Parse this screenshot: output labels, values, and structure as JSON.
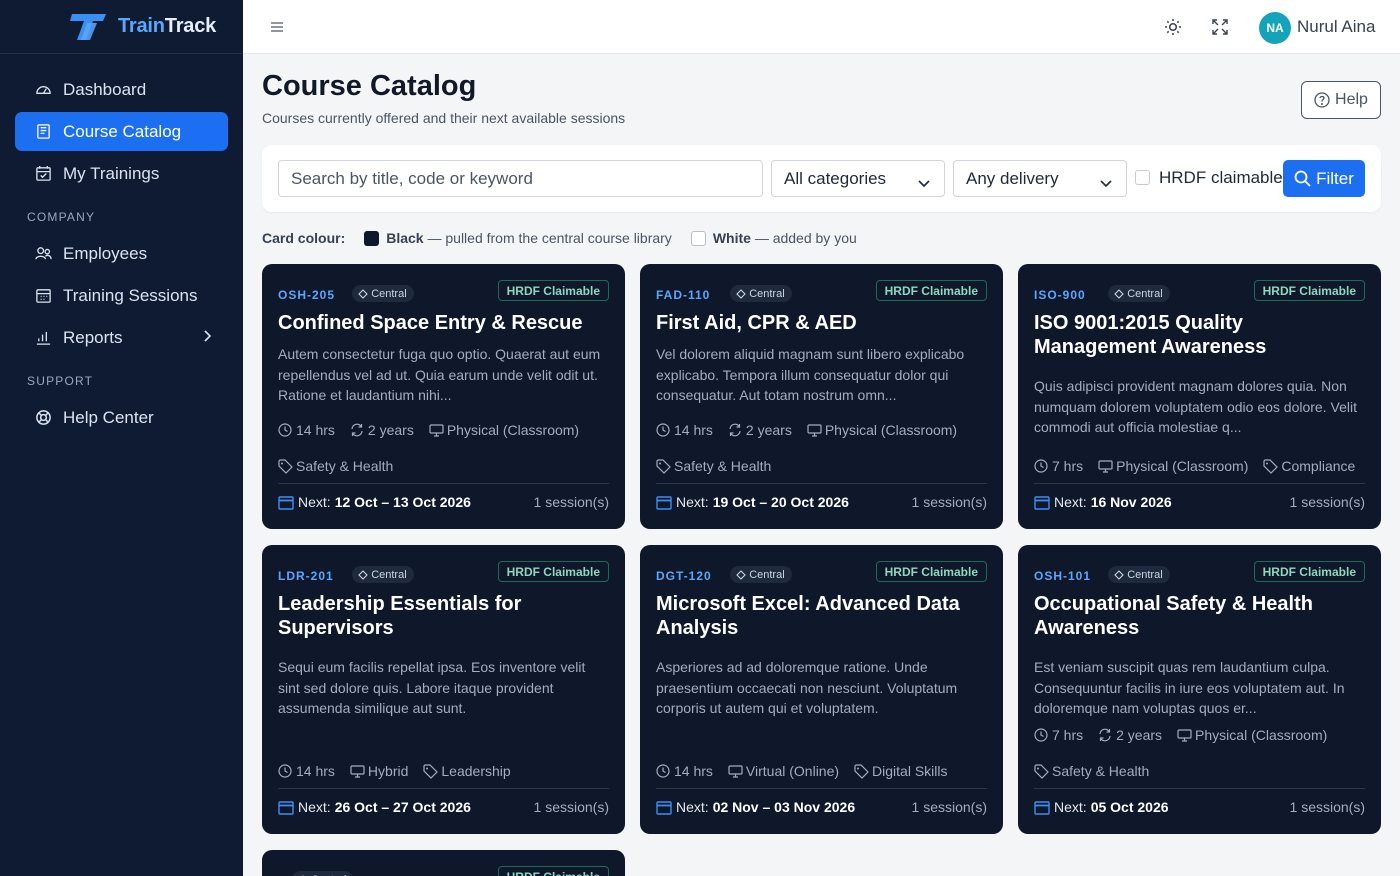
{
  "app": {
    "brand_part1": "Train",
    "brand_part2": "Track"
  },
  "colors": {
    "primary": "#1d6ff2",
    "sidebar": "#0e1b33",
    "card": "#0f172a",
    "code": "#5aa7ff",
    "hrdf": "#8fd7bd",
    "avatar": "#14a3b8"
  },
  "sidebar": {
    "dashboard": {
      "label": "Dashboard",
      "icon": "gauge-icon"
    },
    "course_catalog": {
      "label": "Course Catalog",
      "icon": "book-icon"
    },
    "my_trainings": {
      "label": "My Trainings",
      "icon": "calendar-check-icon"
    },
    "section_company": "COMPANY",
    "employees": {
      "label": "Employees",
      "icon": "users-icon"
    },
    "training_sessions": {
      "label": "Training Sessions",
      "icon": "calendar-grid-icon"
    },
    "reports": {
      "label": "Reports",
      "icon": "bar-chart-icon"
    },
    "section_support": "SUPPORT",
    "help_center": {
      "label": "Help Center",
      "icon": "lifebuoy-icon"
    }
  },
  "topbar": {
    "user_initials": "NA",
    "user_name": "Nurul Aina"
  },
  "header": {
    "title": "Course Catalog",
    "subtitle": "Courses currently offered and their next available sessions",
    "help_label": "Help"
  },
  "filters": {
    "search_placeholder": "Search by title, code or keyword",
    "category": "All categories",
    "delivery": "Any delivery",
    "hrdf_label": "HRDF claimable",
    "filter_label": "Filter"
  },
  "legend": {
    "label": "Card colour:",
    "black": "Black",
    "black_desc": "— pulled from the central course library",
    "white": "White",
    "white_desc": "— added by you"
  },
  "cards": [
    {
      "code": "OSH-205",
      "source": "Central",
      "badge": "HRDF Claimable",
      "title": "Confined Space Entry & Rescue",
      "desc": "Autem consectetur fuga quo optio. Quaerat aut eum repellendus vel ad ut. Quia earum unde velit odit ut. Ratione et laudantium nihi...",
      "hours": "14 hrs",
      "validity": "2 years",
      "delivery": "Physical (Classroom)",
      "category": "Safety & Health",
      "next_label": "Next:",
      "next": "12 Oct – 13 Oct 2026",
      "sessions": "1 session(s)"
    },
    {
      "code": "FAD-110",
      "source": "Central",
      "badge": "HRDF Claimable",
      "title": "First Aid, CPR & AED",
      "desc": "Vel dolorem aliquid magnam sunt libero explicabo explicabo. Tempora illum consequatur dolor qui consequatur. Aut totam nostrum omn...",
      "hours": "14 hrs",
      "validity": "2 years",
      "delivery": "Physical (Classroom)",
      "category": "Safety & Health",
      "next_label": "Next:",
      "next": "19 Oct – 20 Oct 2026",
      "sessions": "1 session(s)"
    },
    {
      "code": "ISO-900",
      "source": "Central",
      "badge": "HRDF Claimable",
      "title": "ISO 9001:2015 Quality Management Awareness",
      "desc": "Quis adipisci provident magnam dolores quia. Non numquam dolorem voluptatem odio eos dolore. Velit commodi aut officia molestiae q...",
      "hours": "7 hrs",
      "delivery": "Physical (Classroom)",
      "category": "Compliance",
      "next_label": "Next:",
      "next": "16 Nov 2026",
      "sessions": "1 session(s)"
    },
    {
      "code": "LDR-201",
      "source": "Central",
      "badge": "HRDF Claimable",
      "title": "Leadership Essentials for Supervisors",
      "desc": "Sequi eum facilis repellat ipsa. Eos inventore velit sint sed dolore quis. Labore itaque provident assumenda similique aut sunt.",
      "hours": "14 hrs",
      "delivery": "Hybrid",
      "category": "Leadership",
      "next_label": "Next:",
      "next": "26 Oct – 27 Oct 2026",
      "sessions": "1 session(s)"
    },
    {
      "code": "DGT-120",
      "source": "Central",
      "badge": "HRDF Claimable",
      "title": "Microsoft Excel: Advanced Data Analysis",
      "desc": "Asperiores ad ad doloremque ratione. Unde praesentium occaecati non nesciunt. Voluptatum corporis ut autem qui et voluptatem.",
      "hours": "14 hrs",
      "delivery": "Virtual (Online)",
      "category": "Digital Skills",
      "next_label": "Next:",
      "next": "02 Nov – 03 Nov 2026",
      "sessions": "1 session(s)"
    },
    {
      "code": "OSH-101",
      "source": "Central",
      "badge": "HRDF Claimable",
      "title": "Occupational Safety & Health Awareness",
      "desc": "Est veniam suscipit quas rem laudantium culpa. Consequuntur facilis in iure eos voluptatem aut. In doloremque nam voluptas quos er...",
      "hours": "7 hrs",
      "validity": "2 years",
      "delivery": "Physical (Classroom)",
      "category": "Safety & Health",
      "next_label": "Next:",
      "next": "05 Oct 2026",
      "sessions": "1 session(s)"
    },
    {
      "code": "",
      "source": "Central",
      "badge": "HRDF Claimable"
    }
  ]
}
